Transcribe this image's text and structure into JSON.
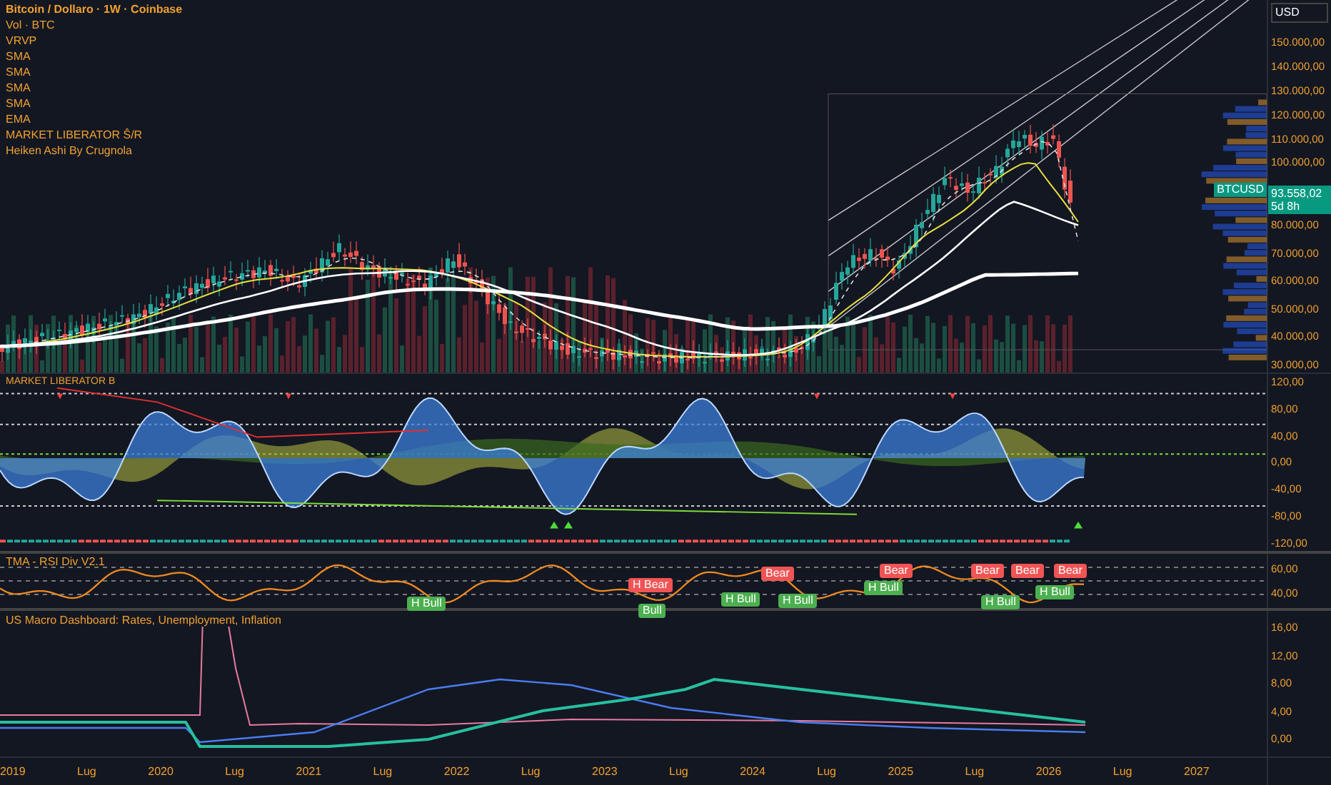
{
  "legend": {
    "title": "Bitcoin / Dollaro · 1W · Coinbase",
    "indicators": [
      "Vol · BTC",
      "VRVP",
      "SMA",
      "SMA",
      "SMA",
      "SMA",
      "EMA",
      "MARKET LIBERATOR Ŝ/R",
      "Heiken Ashi By Crugnola"
    ]
  },
  "price_axis": {
    "currency": "USD",
    "ticks": [
      "150.000,00",
      "140.000,00",
      "130.000,00",
      "120.000,00",
      "110.000,00",
      "100.000,00",
      "80.000,00",
      "70.000,00",
      "60.000,00",
      "50.000,00",
      "40.000,00",
      "30.000,00"
    ],
    "symbol": "BTCUSD",
    "price": "93.558,02",
    "countdown": "5d 8h"
  },
  "oscillator": {
    "title": "MARKET LIBERATOR B",
    "ticks": [
      "120,00",
      "80,00",
      "40,00",
      "0,00",
      "-40,00",
      "-80,00",
      "-120,00"
    ]
  },
  "tma": {
    "title": "TMA - RSI Div V2.1",
    "ticks": [
      "60,00",
      "40,00"
    ],
    "tags": [
      {
        "text": "H Bull",
        "kind": "bull"
      },
      {
        "text": "H Bear",
        "kind": "bear"
      },
      {
        "text": "Bull",
        "kind": "bull"
      },
      {
        "text": "Bear",
        "kind": "bear"
      },
      {
        "text": "H Bull",
        "kind": "bull"
      },
      {
        "text": "H Bull",
        "kind": "bull"
      },
      {
        "text": "Bear",
        "kind": "bear"
      },
      {
        "text": "H Bull",
        "kind": "bull"
      },
      {
        "text": "Bear",
        "kind": "bear"
      },
      {
        "text": "H Bull",
        "kind": "bull"
      },
      {
        "text": "Bear",
        "kind": "bear"
      },
      {
        "text": "H Bull",
        "kind": "bull"
      },
      {
        "text": "Bear",
        "kind": "bear"
      }
    ]
  },
  "macro": {
    "title": "US Macro Dashboard: Rates, Unemployment, Inflation",
    "ticks": [
      "16,00",
      "12,00",
      "8,00",
      "4,00",
      "0,00"
    ]
  },
  "time_axis": [
    "2019",
    "Lug",
    "2020",
    "Lug",
    "2021",
    "Lug",
    "2022",
    "Lug",
    "2023",
    "Lug",
    "2024",
    "Lug",
    "2025",
    "Lug",
    "2026",
    "Lug",
    "2027"
  ]
}
